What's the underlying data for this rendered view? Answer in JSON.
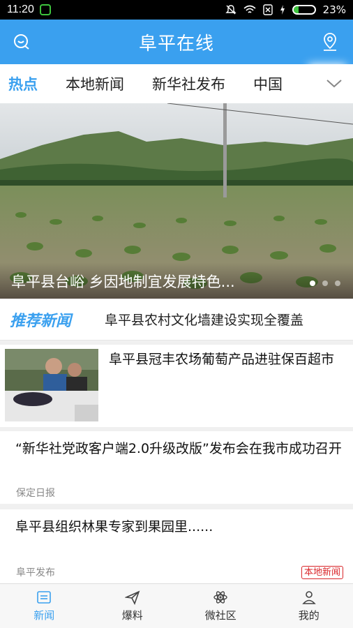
{
  "status_bar": {
    "time": "11:20",
    "battery": "23%",
    "battery_level": 0.23
  },
  "header": {
    "title": "阜平在线"
  },
  "tabs": [
    {
      "label": "热点"
    },
    {
      "label": "本地新闻"
    },
    {
      "label": "新华社发布"
    },
    {
      "label": "中国"
    }
  ],
  "banner": {
    "caption": "阜平县台峪 乡因地制宜发展特色..."
  },
  "recommend": {
    "label": "推荐新闻",
    "headline": "阜平县农村文化墙建设实现全覆盖"
  },
  "news": [
    {
      "headline": "阜平县冠丰农场葡萄产品进驻保百超市"
    },
    {
      "headline": "“新华社党政客户端2.0升级改版”发布会在我市成功召开",
      "source": "保定日报"
    },
    {
      "headline": "阜平县组织林果专家到果园里......",
      "source": "阜平发布",
      "tag": "本地新闻"
    }
  ],
  "bottom_nav": [
    {
      "label": "新闻",
      "icon": "news-icon"
    },
    {
      "label": "爆料",
      "icon": "send-icon"
    },
    {
      "label": "微社区",
      "icon": "atom-icon"
    },
    {
      "label": "我的",
      "icon": "user-icon"
    }
  ],
  "colors": {
    "accent": "#3aa0ef",
    "tag_red": "#d9262a"
  }
}
